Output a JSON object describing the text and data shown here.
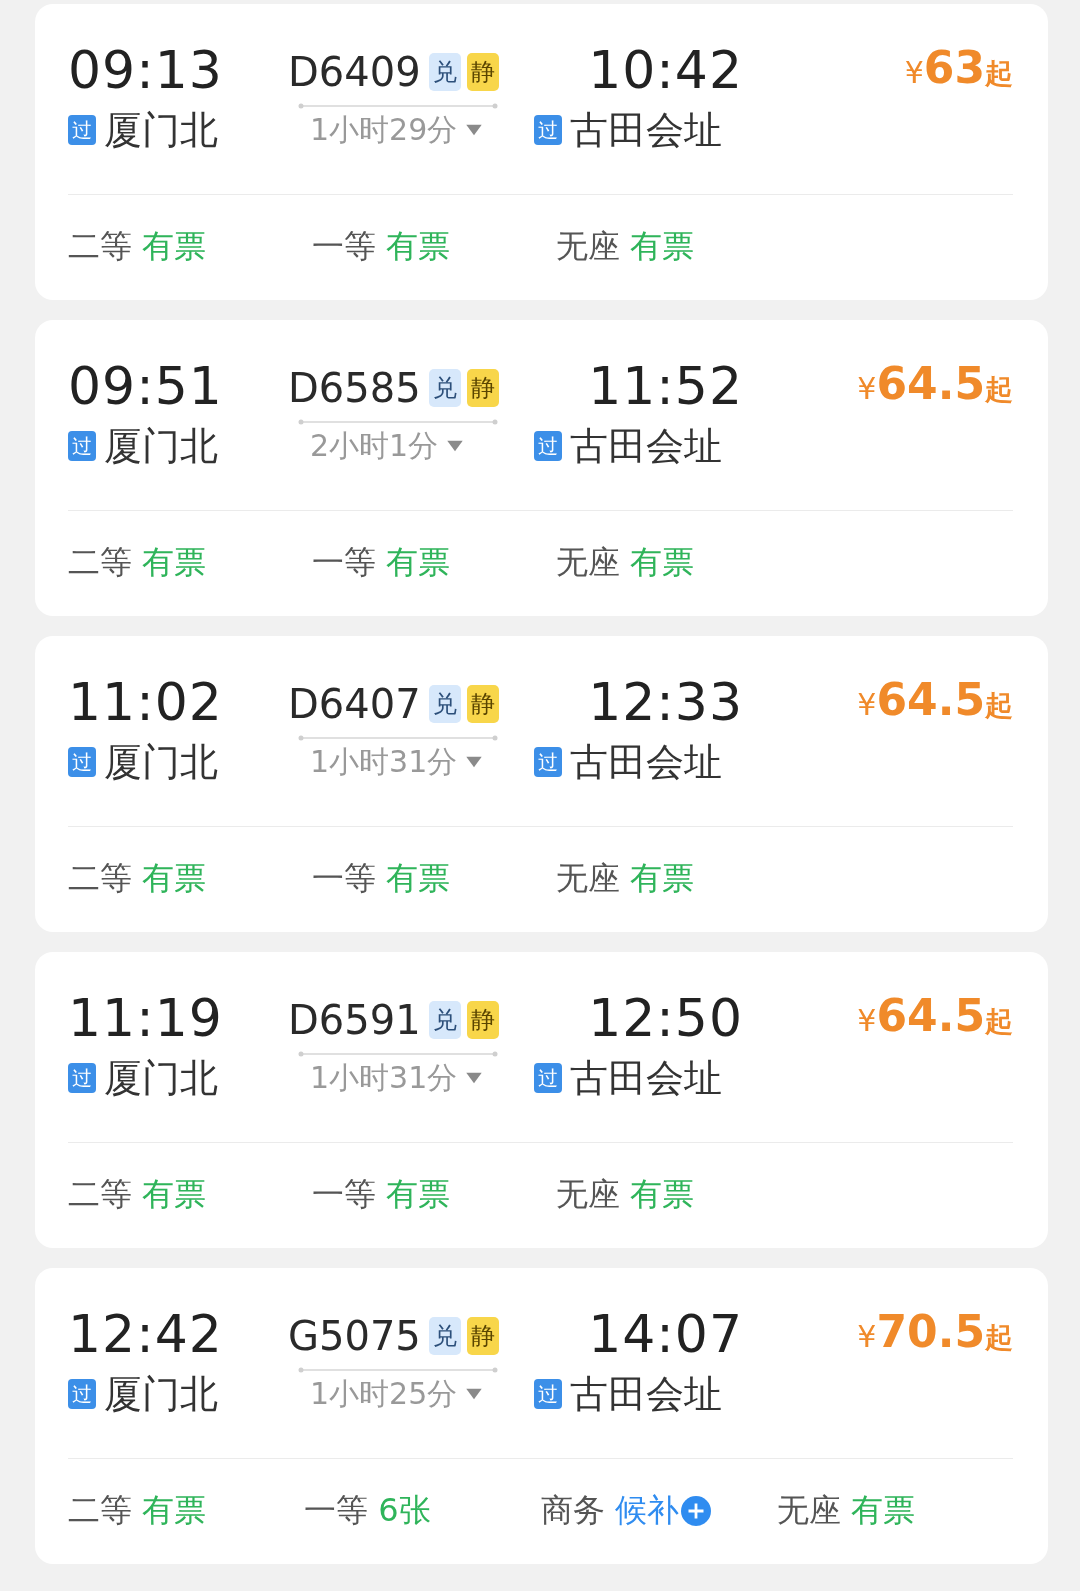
{
  "trains": [
    {
      "depart_time": "09:13",
      "depart_badge": "过",
      "depart_station": "厦门北",
      "train_no": "D6409",
      "tags": [
        {
          "label": "兑",
          "kind": "exchange"
        },
        {
          "label": "静",
          "kind": "quiet"
        }
      ],
      "duration": "1小时29分",
      "arrive_time": "10:42",
      "arrive_badge": "过",
      "arrive_station": "古田会址",
      "price": {
        "currency": "¥",
        "amount": "63",
        "suffix": "起"
      },
      "seats": [
        {
          "class": "二等",
          "status": "有票",
          "kind": "available"
        },
        {
          "class": "一等",
          "status": "有票",
          "kind": "available"
        },
        {
          "class": "无座",
          "status": "有票",
          "kind": "available"
        }
      ]
    },
    {
      "depart_time": "09:51",
      "depart_badge": "过",
      "depart_station": "厦门北",
      "train_no": "D6585",
      "tags": [
        {
          "label": "兑",
          "kind": "exchange"
        },
        {
          "label": "静",
          "kind": "quiet"
        }
      ],
      "duration": "2小时1分",
      "arrive_time": "11:52",
      "arrive_badge": "过",
      "arrive_station": "古田会址",
      "price": {
        "currency": "¥",
        "amount": "64.5",
        "suffix": "起"
      },
      "seats": [
        {
          "class": "二等",
          "status": "有票",
          "kind": "available"
        },
        {
          "class": "一等",
          "status": "有票",
          "kind": "available"
        },
        {
          "class": "无座",
          "status": "有票",
          "kind": "available"
        }
      ]
    },
    {
      "depart_time": "11:02",
      "depart_badge": "过",
      "depart_station": "厦门北",
      "train_no": "D6407",
      "tags": [
        {
          "label": "兑",
          "kind": "exchange"
        },
        {
          "label": "静",
          "kind": "quiet"
        }
      ],
      "duration": "1小时31分",
      "arrive_time": "12:33",
      "arrive_badge": "过",
      "arrive_station": "古田会址",
      "price": {
        "currency": "¥",
        "amount": "64.5",
        "suffix": "起"
      },
      "seats": [
        {
          "class": "二等",
          "status": "有票",
          "kind": "available"
        },
        {
          "class": "一等",
          "status": "有票",
          "kind": "available"
        },
        {
          "class": "无座",
          "status": "有票",
          "kind": "available"
        }
      ]
    },
    {
      "depart_time": "11:19",
      "depart_badge": "过",
      "depart_station": "厦门北",
      "train_no": "D6591",
      "tags": [
        {
          "label": "兑",
          "kind": "exchange"
        },
        {
          "label": "静",
          "kind": "quiet"
        }
      ],
      "duration": "1小时31分",
      "arrive_time": "12:50",
      "arrive_badge": "过",
      "arrive_station": "古田会址",
      "price": {
        "currency": "¥",
        "amount": "64.5",
        "suffix": "起"
      },
      "seats": [
        {
          "class": "二等",
          "status": "有票",
          "kind": "available"
        },
        {
          "class": "一等",
          "status": "有票",
          "kind": "available"
        },
        {
          "class": "无座",
          "status": "有票",
          "kind": "available"
        }
      ]
    },
    {
      "depart_time": "12:42",
      "depart_badge": "过",
      "depart_station": "厦门北",
      "train_no": "G5075",
      "tags": [
        {
          "label": "兑",
          "kind": "exchange"
        },
        {
          "label": "静",
          "kind": "quiet"
        }
      ],
      "duration": "1小时25分",
      "arrive_time": "14:07",
      "arrive_badge": "过",
      "arrive_station": "古田会址",
      "price": {
        "currency": "¥",
        "amount": "70.5",
        "suffix": "起"
      },
      "seats": [
        {
          "class": "二等",
          "status": "有票",
          "kind": "available"
        },
        {
          "class": "一等",
          "status": "6张",
          "kind": "available"
        },
        {
          "class": "商务",
          "status": "候补",
          "kind": "waitlist"
        },
        {
          "class": "无座",
          "status": "有票",
          "kind": "available"
        }
      ]
    }
  ]
}
